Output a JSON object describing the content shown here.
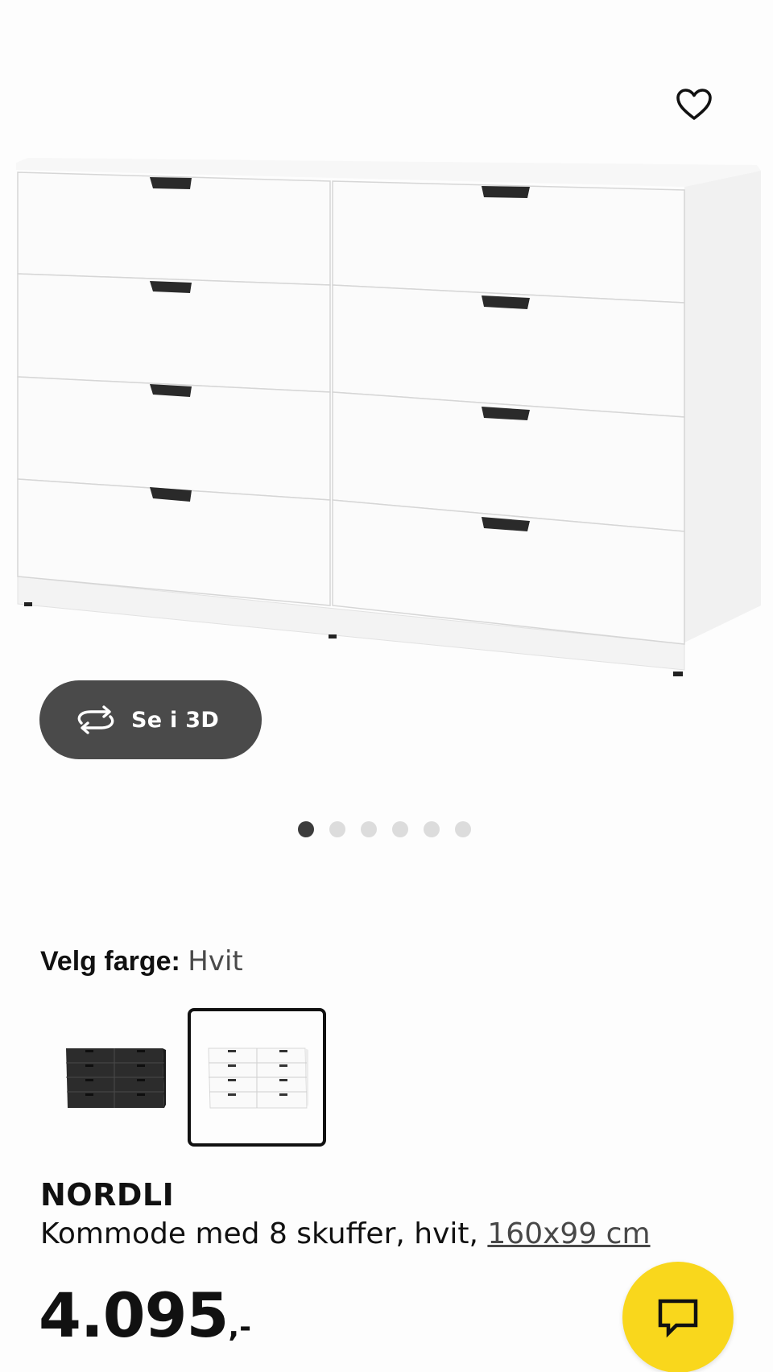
{
  "hero": {
    "favorite_icon": "heart-icon",
    "view_3d_label": "Se i 3D",
    "view_3d_icon": "rotate-3d-icon",
    "carousel": {
      "total": 6,
      "active_index": 0
    }
  },
  "color": {
    "label": "Velg farge:",
    "value": "Hvit",
    "options": [
      {
        "name": "black",
        "selected": false
      },
      {
        "name": "white",
        "selected": true
      }
    ]
  },
  "product": {
    "name": "NORDLI",
    "description": "Kommode med 8 skuffer, hvit, ",
    "size_link": "160x99 cm",
    "price_main": "4.095",
    "price_suffix": ",-"
  },
  "chat": {
    "icon": "chat-icon",
    "color": "#f9d71c"
  },
  "colors": {
    "accent_yellow": "#f9d71c",
    "button_dark": "#4a4a4a"
  }
}
